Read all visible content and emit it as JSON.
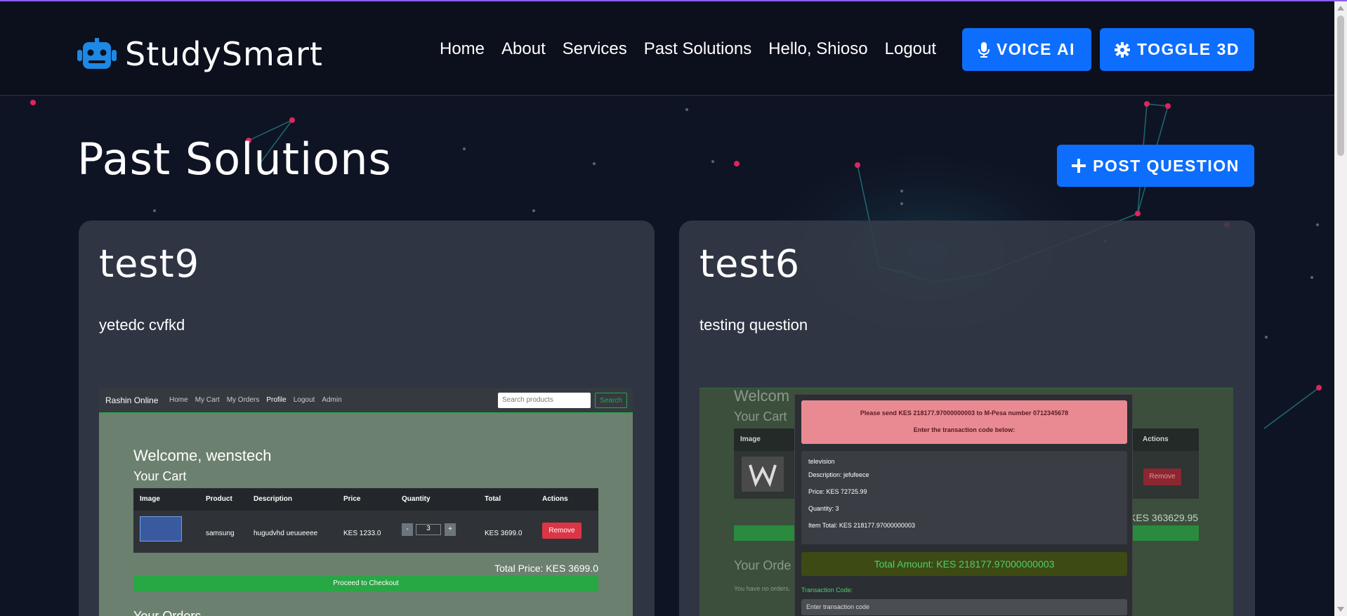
{
  "brand": {
    "name": "StudySmart"
  },
  "nav": {
    "links": [
      "Home",
      "About",
      "Services",
      "Past Solutions",
      "Hello, Shioso",
      "Logout"
    ],
    "voice_label": "VOICE AI",
    "toggle_label": "TOGGLE 3D"
  },
  "page": {
    "title": "Past Solutions",
    "post_label": "POST QUESTION"
  },
  "cards": [
    {
      "title": "test9",
      "description": "yetedc cvfkd",
      "screenshot": {
        "brand": "Rashin Online",
        "links": [
          "Home",
          "My Cart",
          "My Orders",
          "Profile",
          "Logout",
          "Admin"
        ],
        "search_placeholder": "Search products",
        "search_button": "Search",
        "welcome": "Welcome, wenstech",
        "cart_heading": "Your Cart",
        "columns": [
          "Image",
          "Product",
          "Description",
          "Price",
          "Quantity",
          "Total",
          "Actions"
        ],
        "row": {
          "product": "samsung",
          "description": "hugudvhd ueuueeee",
          "price": "KES 1233.0",
          "minus": "-",
          "quantity": "3",
          "plus": "+",
          "total": "KES 3699.0",
          "remove": "Remove"
        },
        "total_price": "Total Price: KES 3699.0",
        "checkout": "Proceed to Checkout",
        "orders_heading": "Your Orders"
      }
    },
    {
      "title": "test6",
      "description": "testing question",
      "screenshot": {
        "bg_welcome": "Welcom",
        "bg_cart": "Your Cart",
        "bg_col_image": "Image",
        "bg_col_actions": "Actions",
        "bg_remove": "Remove",
        "bg_total": "KES 363629.95",
        "bg_orders": "Your Orde",
        "bg_no_orders": "You have no orders.",
        "alert_line1": "Please send KES 218177.97000000003 to M-Pesa number 0712345678",
        "alert_line2": "Enter the transaction code below:",
        "item_name": "television",
        "item_description": "Description: jefufeece",
        "item_price": "Price: KES 72725.99",
        "item_quantity": "Quantity: 3",
        "item_total": "Item Total: KES 218177.97000000003",
        "total_amount": "Total Amount: KES 218177.97000000003",
        "code_label": "Transaction Code:",
        "code_placeholder": "Enter transaction code"
      }
    }
  ],
  "colors": {
    "accent": "#0d6efd",
    "background": "#0f1424",
    "card": "#343a48",
    "top_line": "#8b5cf6"
  }
}
